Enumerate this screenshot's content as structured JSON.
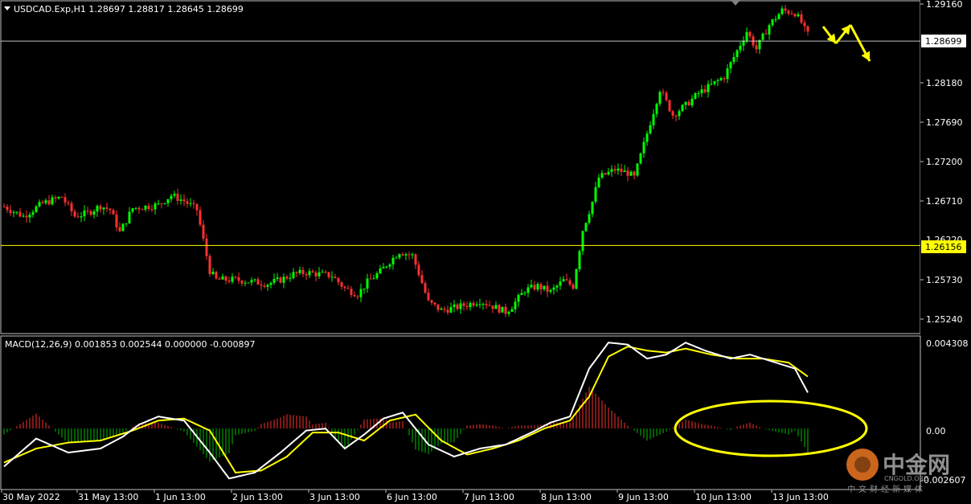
{
  "main_chart": {
    "header": "USDCAD.Exp,H1  1.28697 1.28817 1.28645 1.28699",
    "price_ticks": [
      "1.29160",
      "1.28180",
      "1.27690",
      "1.27200",
      "1.26710",
      "1.25730",
      "1.25240"
    ],
    "hidden_tick": "1.26220",
    "current_price_label": "1.28699",
    "yellow_level_label": "1.26156",
    "colors": {
      "bull": "#00ff00",
      "bear": "#ff3030",
      "grid": "#c0c0c0",
      "yellow_line": "#ffff00",
      "current_line": "#ffffff",
      "background": "#000000"
    }
  },
  "macd": {
    "header": "MACD(12,26,9) 0.001853 0.002544 0.000000 -0.000897",
    "ticks": [
      "0.004308",
      "0.00",
      "-0.002607"
    ],
    "colors": {
      "macd_line": "#ffffff",
      "signal_line": "#ffff00",
      "hist_pos": "#ff3030",
      "hist_neg": "#00c000"
    }
  },
  "time_axis": [
    "30 May 2022",
    "31 May 13:00",
    "1 Jun 13:00",
    "2 Jun 13:00",
    "3 Jun 13:00",
    "6 Jun 13:00",
    "7 Jun 13:00",
    "8 Jun 13:00",
    "9 Jun 13:00",
    "10 Jun 13:00",
    "13 Jun 13:00"
  ],
  "watermark": {
    "brand": "中金网",
    "domain": "CNGOLD.ORG",
    "tagline": "中文财经新媒体"
  },
  "chart_data": {
    "type": "candlestick",
    "title": "USDCAD.Exp,H1",
    "ohlc_last": {
      "open": 1.28697,
      "high": 1.28817,
      "low": 1.28645,
      "close": 1.28699
    },
    "price_ylim": [
      1.2505,
      1.2935
    ],
    "price_path": [
      [
        0,
        1.2664
      ],
      [
        6,
        1.2652
      ],
      [
        12,
        1.2668
      ],
      [
        18,
        1.2676
      ],
      [
        22,
        1.2652
      ],
      [
        26,
        1.2656
      ],
      [
        30,
        1.2665
      ],
      [
        33,
        1.266
      ],
      [
        36,
        1.2632
      ],
      [
        40,
        1.2662
      ],
      [
        44,
        1.2664
      ],
      [
        48,
        1.2666
      ],
      [
        52,
        1.2678
      ],
      [
        56,
        1.2671
      ],
      [
        60,
        1.266
      ],
      [
        64,
        1.2584
      ],
      [
        66,
        1.2573
      ],
      [
        72,
        1.2573
      ],
      [
        78,
        1.257
      ],
      [
        82,
        1.2568
      ],
      [
        86,
        1.2573
      ],
      [
        90,
        1.258
      ],
      [
        94,
        1.2582
      ],
      [
        98,
        1.258
      ],
      [
        102,
        1.2578
      ],
      [
        106,
        1.2562
      ],
      [
        110,
        1.2555
      ],
      [
        113,
        1.257
      ],
      [
        117,
        1.2583
      ],
      [
        120,
        1.2596
      ],
      [
        123,
        1.2608
      ],
      [
        127,
        1.2603
      ],
      [
        129,
        1.2581
      ],
      [
        132,
        1.2545
      ],
      [
        136,
        1.2535
      ],
      [
        140,
        1.2538
      ],
      [
        144,
        1.2542
      ],
      [
        148,
        1.2547
      ],
      [
        152,
        1.254
      ],
      [
        156,
        1.2533
      ],
      [
        158,
        1.254
      ],
      [
        162,
        1.256
      ],
      [
        166,
        1.2565
      ],
      [
        170,
        1.2558
      ],
      [
        174,
        1.2572
      ],
      [
        177,
        1.2565
      ],
      [
        180,
        1.2635
      ],
      [
        183,
        1.267
      ],
      [
        185,
        1.27
      ],
      [
        190,
        1.271
      ],
      [
        194,
        1.2706
      ],
      [
        196,
        1.27
      ],
      [
        200,
        1.2755
      ],
      [
        204,
        1.281
      ],
      [
        208,
        1.2778
      ],
      [
        212,
        1.279
      ],
      [
        216,
        1.2805
      ],
      [
        220,
        1.2815
      ],
      [
        224,
        1.2826
      ],
      [
        228,
        1.2858
      ],
      [
        231,
        1.2882
      ],
      [
        234,
        1.286
      ],
      [
        238,
        1.289
      ],
      [
        242,
        1.2908
      ],
      [
        246,
        1.2905
      ],
      [
        248,
        1.2893
      ],
      [
        249,
        1.2884
      ],
      [
        250,
        1.2878
      ]
    ],
    "projection_arrows": [
      [
        1.2888,
        1.2867,
        1.289,
        1.2845
      ]
    ],
    "horizontal_levels": {
      "current": 1.28699,
      "support": 1.26156
    },
    "macd": {
      "values": {
        "macd": 0.001853,
        "signal": 0.002544,
        "extra": [
          0.0,
          -0.000897
        ]
      },
      "ylim": [
        -0.002607,
        0.004308
      ],
      "macd_line": [
        [
          0,
          -0.0019
        ],
        [
          10,
          -0.0005
        ],
        [
          20,
          -0.0012
        ],
        [
          30,
          -0.001
        ],
        [
          37,
          -0.0004
        ],
        [
          42,
          0.0002
        ],
        [
          48,
          0.0006
        ],
        [
          56,
          0.0004
        ],
        [
          64,
          -0.0012
        ],
        [
          70,
          -0.0025
        ],
        [
          78,
          -0.0022
        ],
        [
          86,
          -0.0012
        ],
        [
          94,
          -0.0001
        ],
        [
          100,
          0.0
        ],
        [
          106,
          -0.001
        ],
        [
          112,
          -0.0003
        ],
        [
          118,
          0.0005
        ],
        [
          124,
          0.0008
        ],
        [
          132,
          -0.0008
        ],
        [
          140,
          -0.0014
        ],
        [
          148,
          -0.001
        ],
        [
          156,
          -0.0008
        ],
        [
          164,
          -0.0002
        ],
        [
          170,
          0.0003
        ],
        [
          176,
          0.0006
        ],
        [
          182,
          0.003
        ],
        [
          188,
          0.0043
        ],
        [
          194,
          0.0042
        ],
        [
          200,
          0.0035
        ],
        [
          206,
          0.0037
        ],
        [
          212,
          0.0043
        ],
        [
          218,
          0.0039
        ],
        [
          226,
          0.0035
        ],
        [
          232,
          0.0037
        ],
        [
          240,
          0.0033
        ],
        [
          246,
          0.003
        ],
        [
          250,
          0.0018
        ]
      ],
      "signal_line": [
        [
          0,
          -0.0017
        ],
        [
          10,
          -0.001
        ],
        [
          20,
          -0.0007
        ],
        [
          30,
          -0.0006
        ],
        [
          40,
          -0.0001
        ],
        [
          48,
          0.0004
        ],
        [
          56,
          0.0005
        ],
        [
          64,
          -0.0001
        ],
        [
          72,
          -0.0022
        ],
        [
          80,
          -0.0021
        ],
        [
          88,
          -0.0014
        ],
        [
          96,
          -0.0002
        ],
        [
          104,
          -0.0002
        ],
        [
          112,
          -0.0006
        ],
        [
          120,
          0.0004
        ],
        [
          128,
          0.0007
        ],
        [
          136,
          -0.0006
        ],
        [
          144,
          -0.0013
        ],
        [
          152,
          -0.001
        ],
        [
          160,
          -0.0006
        ],
        [
          168,
          0.0
        ],
        [
          176,
          0.0004
        ],
        [
          182,
          0.0016
        ],
        [
          188,
          0.0036
        ],
        [
          194,
          0.0041
        ],
        [
          200,
          0.0039
        ],
        [
          206,
          0.0038
        ],
        [
          212,
          0.004
        ],
        [
          220,
          0.0037
        ],
        [
          228,
          0.0035
        ],
        [
          236,
          0.0035
        ],
        [
          244,
          0.0033
        ],
        [
          250,
          0.0026
        ]
      ]
    }
  }
}
